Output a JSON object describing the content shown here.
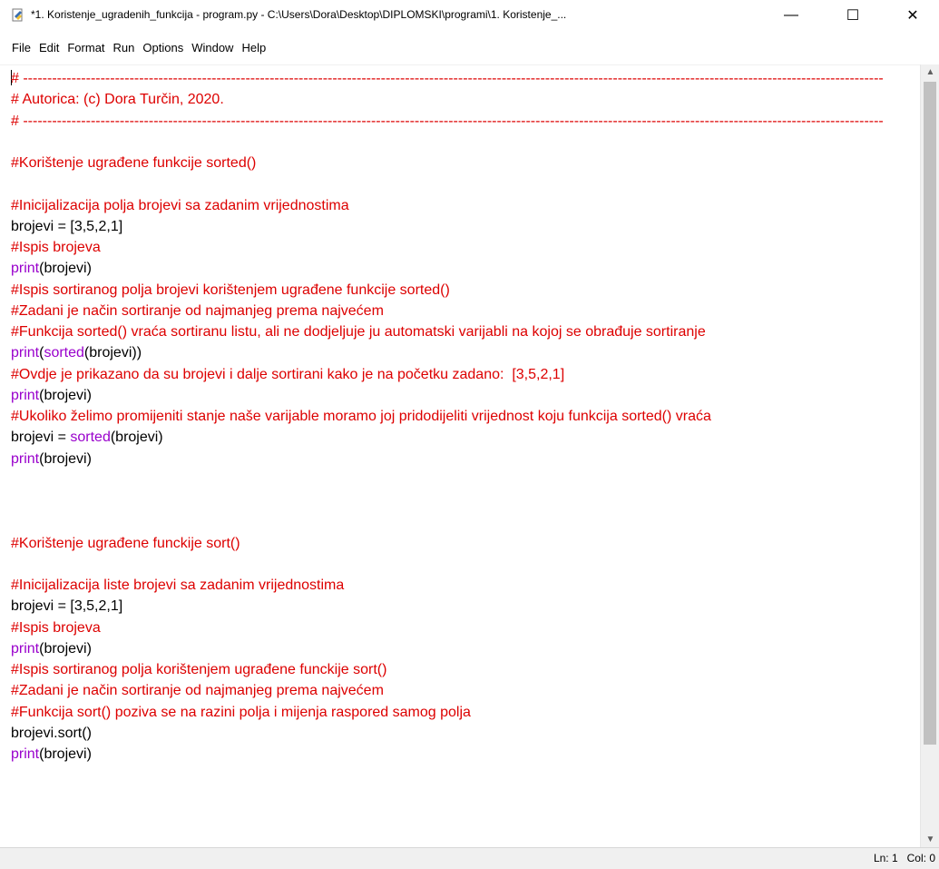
{
  "window": {
    "title": "*1. Koristenje_ugradenih_funkcija - program.py - C:\\Users\\Dora\\Desktop\\DIPLOMSKI\\programi\\1. Koristenje_...",
    "minimize_glyph": "—",
    "maximize_glyph": "☐",
    "close_glyph": "✕"
  },
  "menu": [
    "File",
    "Edit",
    "Format",
    "Run",
    "Options",
    "Window",
    "Help"
  ],
  "code_lines": [
    [
      {
        "t": "cm",
        "s": "# ----------------------------------------------------------------------------------------------------------------------------------------------------------------------------------"
      }
    ],
    [
      {
        "t": "cm",
        "s": "# Autorica: (c) Dora Turčin, 2020."
      }
    ],
    [
      {
        "t": "cm",
        "s": "# ----------------------------------------------------------------------------------------------------------------------------------------------------------------------------------"
      }
    ],
    [],
    [
      {
        "t": "cm",
        "s": "#Korištenje ugrađene funkcije sorted()"
      }
    ],
    [],
    [
      {
        "t": "cm",
        "s": "#Inicijalizacija polja brojevi sa zadanim vrijednostima"
      }
    ],
    [
      {
        "t": "tx",
        "s": "brojevi = [3,5,2,1]"
      }
    ],
    [
      {
        "t": "cm",
        "s": "#Ispis brojeva"
      }
    ],
    [
      {
        "t": "kw",
        "s": "print"
      },
      {
        "t": "tx",
        "s": "(brojevi)"
      }
    ],
    [
      {
        "t": "cm",
        "s": "#Ispis sortiranog polja brojevi korištenjem ugrađene funkcije sorted()"
      }
    ],
    [
      {
        "t": "cm",
        "s": "#Zadani je način sortiranje od najmanjeg prema najvećem"
      }
    ],
    [
      {
        "t": "cm",
        "s": "#Funkcija sorted() vraća sortiranu listu, ali ne dodjeljuje ju automatski varijabli na kojoj se obrađuje sortiranje"
      }
    ],
    [
      {
        "t": "kw",
        "s": "print"
      },
      {
        "t": "tx",
        "s": "("
      },
      {
        "t": "kw",
        "s": "sorted"
      },
      {
        "t": "tx",
        "s": "(brojevi))"
      }
    ],
    [
      {
        "t": "cm",
        "s": "#Ovdje je prikazano da su brojevi i dalje sortirani kako je na početku zadano:  [3,5,2,1]"
      }
    ],
    [
      {
        "t": "kw",
        "s": "print"
      },
      {
        "t": "tx",
        "s": "(brojevi)"
      }
    ],
    [
      {
        "t": "cm",
        "s": "#Ukoliko želimo promijeniti stanje naše varijable moramo joj pridodijeliti vrijednost koju funkcija sorted() vraća"
      }
    ],
    [
      {
        "t": "tx",
        "s": "brojevi = "
      },
      {
        "t": "kw",
        "s": "sorted"
      },
      {
        "t": "tx",
        "s": "(brojevi)"
      }
    ],
    [
      {
        "t": "kw",
        "s": "print"
      },
      {
        "t": "tx",
        "s": "(brojevi)"
      }
    ],
    [],
    [],
    [],
    [
      {
        "t": "cm",
        "s": "#Korištenje ugrađene funckije sort()"
      }
    ],
    [],
    [
      {
        "t": "cm",
        "s": "#Inicijalizacija liste brojevi sa zadanim vrijednostima"
      }
    ],
    [
      {
        "t": "tx",
        "s": "brojevi = [3,5,2,1]"
      }
    ],
    [
      {
        "t": "cm",
        "s": "#Ispis brojeva"
      }
    ],
    [
      {
        "t": "kw",
        "s": "print"
      },
      {
        "t": "tx",
        "s": "(brojevi)"
      }
    ],
    [
      {
        "t": "cm",
        "s": "#Ispis sortiranog polja korištenjem ugrađene funckije sort()"
      }
    ],
    [
      {
        "t": "cm",
        "s": "#Zadani je način sortiranje od najmanjeg prema najvećem"
      }
    ],
    [
      {
        "t": "cm",
        "s": "#Funkcija sort() poziva se na razini polja i mijenja raspored samog polja"
      }
    ],
    [
      {
        "t": "tx",
        "s": "brojevi.sort()"
      }
    ],
    [
      {
        "t": "kw",
        "s": "print"
      },
      {
        "t": "tx",
        "s": "(brojevi)"
      }
    ]
  ],
  "status": {
    "text": "Ln: 1   Col: 0"
  },
  "colors": {
    "comment": "#dd0000",
    "builtin": "#9900cc",
    "text": "#000000"
  }
}
